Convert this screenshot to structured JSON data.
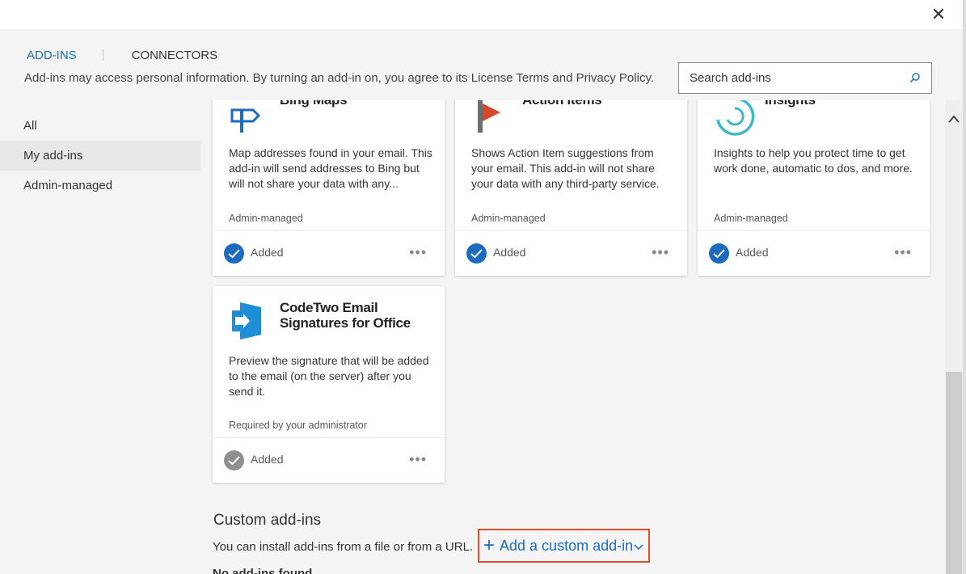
{
  "dialog": {
    "close_glyph": "✕"
  },
  "tabs": [
    {
      "label": "ADD-INS",
      "active": true
    },
    {
      "label": "CONNECTORS",
      "active": false
    }
  ],
  "notice": "Add-ins may access personal information. By turning an add-in on, you agree to its License Terms and Privacy Policy.",
  "search": {
    "placeholder": "Search add-ins",
    "icon": "search-icon"
  },
  "sidebar": {
    "items": [
      {
        "label": "All",
        "selected": false
      },
      {
        "label": "My add-ins",
        "selected": true
      },
      {
        "label": "Admin-managed",
        "selected": false
      }
    ]
  },
  "cards": [
    {
      "title": "Bing Maps",
      "icon": "signpost-icon",
      "description": "Map addresses found in your email. This add-in will send addresses to Bing but will not share your data with any...",
      "meta": "Admin-managed",
      "status": "Added",
      "check_color": "#1c6bbf"
    },
    {
      "title": "Action Items",
      "icon": "flag-icon",
      "description": "Shows Action Item suggestions from your email. This add-in will not share your data with any third-party service.",
      "meta": "Admin-managed",
      "status": "Added",
      "check_color": "#1c6bbf"
    },
    {
      "title": "Insights",
      "icon": "insights-icon",
      "description": "Insights to help you protect time to get work done, automatic to dos, and more.",
      "meta": "Admin-managed",
      "status": "Added",
      "check_color": "#1c6bbf"
    },
    {
      "title_line1": "CodeTwo Email",
      "title_line2": "Signatures for Office",
      "icon": "codetwo-icon",
      "description": "Preview the signature that will be added to the email (on the server) after you send it.",
      "meta": "Required by your administrator",
      "status": "Added",
      "check_color": "#8f8f8f"
    }
  ],
  "more_glyph": "•••",
  "custom": {
    "heading": "Custom add-ins",
    "description": "You can install add-ins from a file or from a URL.",
    "add_button_label": "Add a custom add-in",
    "plus_glyph": "+",
    "empty_text": "No add-ins found"
  },
  "colors": {
    "accent": "#1c6bbf",
    "highlight_border": "#e24b2c",
    "action_flag": "#d9472b",
    "insights": "#3fb8c9",
    "codetwo": "#1e8fd6"
  }
}
